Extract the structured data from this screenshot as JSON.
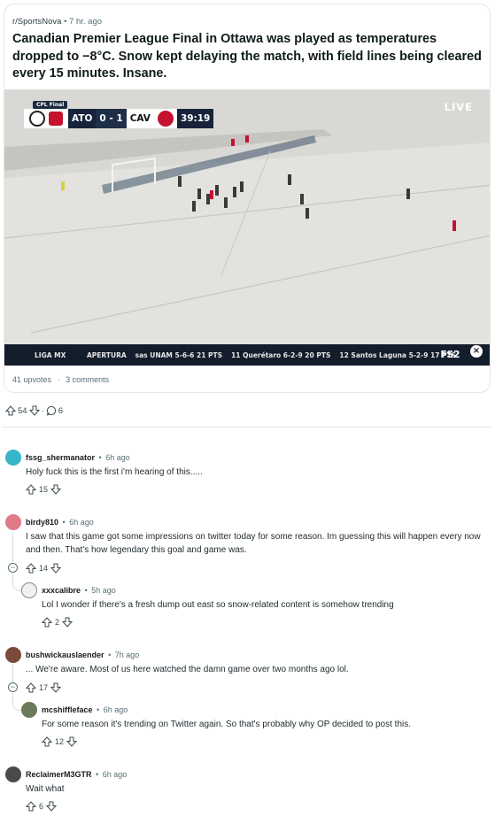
{
  "post": {
    "subreddit": "r/SportsNova",
    "separator": "•",
    "time": "7 hr. ago",
    "title": "Canadian Premier League Final in Ottawa was played as temperatures dropped to −8°C. Snow kept delaying the match, with field lines being cleared every 15 minutes. Insane.",
    "upvotes_text": "41 upvotes",
    "dot": "·",
    "comments_text": "3 comments"
  },
  "media": {
    "bug_label": "CPL Final",
    "home_team": "ATO",
    "score": "0 - 1",
    "away_team": "CAV",
    "clock": "39:19",
    "live": "LIVE",
    "ticker_league": "LIGA MX",
    "ticker_items": [
      {
        "text": "APERTURA"
      },
      {
        "text": "sas UNAM 5-6-6 21 PTS"
      },
      {
        "text": "11 Querétaro 6-2-9 20 PTS"
      },
      {
        "text": "12 Santos Laguna 5-2-9 17 PTS"
      }
    ],
    "network": "FS2",
    "close": "×"
  },
  "actions": {
    "votes": "54",
    "dot": "·",
    "comments": "6"
  },
  "comments": [
    {
      "user": "fssg_shermanator",
      "sep": "•",
      "time": "6h ago",
      "body": "Holy fuck this is the first i'm hearing of this.....",
      "votes": "15"
    },
    {
      "user": "birdy810",
      "sep": "•",
      "time": "6h ago",
      "body": "I saw that this game got some impressions on twitter today for some reason. Im guessing this will happen every now and then. That's how legendary this goal and game was.",
      "votes": "14"
    },
    {
      "user": "xxxcalibre",
      "sep": "•",
      "time": "5h ago",
      "body": "Lol I wonder if there's a fresh dump out east so snow-related content is somehow trending",
      "votes": "2"
    },
    {
      "user": "bushwickauslaender",
      "sep": "•",
      "time": "7h ago",
      "body": "... We're aware. Most of us here watched the damn game over two months ago lol.",
      "votes": "17"
    },
    {
      "user": "mcshiffleface",
      "sep": "•",
      "time": "6h ago",
      "body": "For some reason it's trending on Twitter again. So that's probably why OP decided to post this.",
      "votes": "12"
    },
    {
      "user": "ReclaimerM3GTR",
      "sep": "•",
      "time": "6h ago",
      "body": "Wait what",
      "votes": "6"
    }
  ],
  "colors": {
    "accent_red": "#c4122f",
    "navy": "#17233a",
    "muted": "#576f76"
  },
  "icons": {
    "upvote": "upvote-icon",
    "downvote": "downvote-icon",
    "comment": "comment-icon",
    "collapse": "collapse-icon"
  }
}
